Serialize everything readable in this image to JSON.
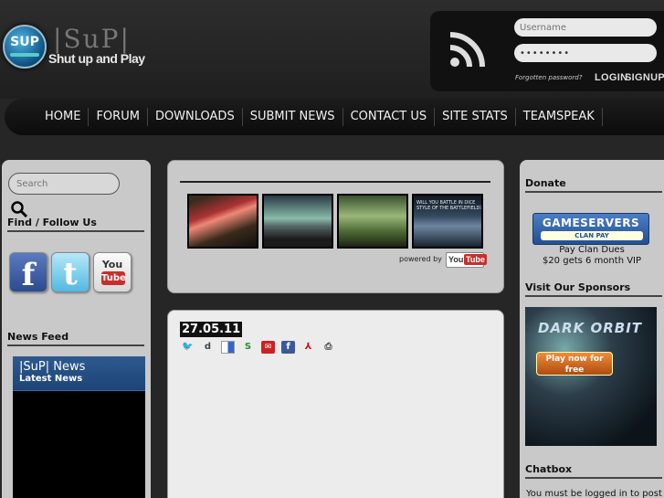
{
  "header": {
    "logo_badge": "SUP",
    "brand": "|SuP|",
    "tagline": "Shut up and Play",
    "login": {
      "username_placeholder": "Username",
      "password_value": "••••••••",
      "forgot_label": "Forgotten password?",
      "login_label": "LOGIN",
      "signup_label": "SIGNUP"
    }
  },
  "nav": {
    "items": [
      "HOME",
      "FORUM",
      "DOWNLOADS",
      "SUBMIT NEWS",
      "CONTACT US",
      "SITE STATS",
      "TEAMSPEAK"
    ]
  },
  "left_sidebar": {
    "search_placeholder": "Search",
    "find_follow_heading": "Find / Follow Us",
    "social": {
      "facebook": "f",
      "twitter": "t",
      "youtube_top": "You",
      "youtube_bottom": "Tube"
    },
    "news_feed_heading": "News Feed",
    "news_widget_title": "|SuP| News",
    "news_widget_subtitle": "Latest News"
  },
  "video_panel": {
    "thumb_captions": [
      "",
      "",
      "",
      "WILL YOU BATTLE IN DICE STYLE OF THE BATTLEFIELD?"
    ],
    "powered_by": "powered by",
    "youtube_you": "You",
    "youtube_tube": "Tube"
  },
  "article": {
    "date": "27.05.11",
    "share_icons": [
      "twitter-icon",
      "digg-icon",
      "delicious-icon",
      "stumbleupon-icon",
      "email-icon",
      "facebook-icon",
      "pdf-icon",
      "print-icon"
    ]
  },
  "right_sidebar": {
    "donate_heading": "Donate",
    "gs_name": "GAMESERVERS",
    "gs_pay": "CLAN PAY",
    "donate_line1": "Pay Clan Dues",
    "donate_line2": "$20 gets 6 month VIP",
    "sponsors_heading": "Visit Our Sponsors",
    "sponsor_logo": "DARK ORBIT",
    "sponsor_button": "Play now for free",
    "chatbox_heading": "Chatbox",
    "chat_text": "You must be logged in to post"
  }
}
